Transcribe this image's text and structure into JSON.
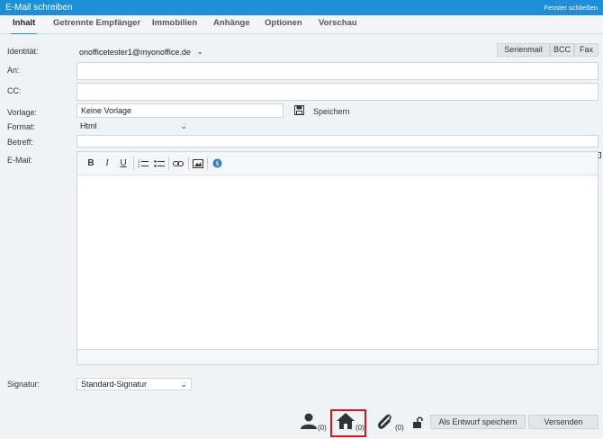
{
  "window": {
    "title": "E-Mail schreiben",
    "close_label": "Fenster schließen"
  },
  "tabs": [
    {
      "label": "Inhalt",
      "active": true
    },
    {
      "label": "Getrennte Empfänger",
      "active": false
    },
    {
      "label": "Immobilien",
      "active": false
    },
    {
      "label": "Anhänge",
      "active": false
    },
    {
      "label": "Optionen",
      "active": false
    },
    {
      "label": "Vorschau",
      "active": false
    }
  ],
  "form": {
    "identity_label": "Identität:",
    "identity_value": "onofficetester1@myonoffice.de",
    "to_label": "An:",
    "cc_label": "CC:",
    "template_label": "Vorlage:",
    "template_value": "Keine Vorlage",
    "save_template_label": "Speichern",
    "format_label": "Format:",
    "format_value": "Html",
    "subject_label": "Betreff:",
    "email_label": "E-Mail:",
    "signature_label": "Signatur:",
    "signature_value": "Standard-Signatur"
  },
  "top_buttons": {
    "serienmail": "Serienmail",
    "bcc": "BCC",
    "fax": "Fax"
  },
  "editor_toolbar": [
    "bold",
    "italic",
    "underline",
    "ordered-list",
    "unordered-list",
    "link",
    "image",
    "special"
  ],
  "toolbar_glyphs": {
    "bold": "B",
    "italic": "I",
    "underline": "U"
  },
  "footer": {
    "contacts_count": "(0)",
    "properties_count": "(0)",
    "attachments_count": "(0)",
    "draft_button": "Als Entwurf speichern",
    "send_button": "Versenden"
  },
  "colors": {
    "accent": "#1d8fd6",
    "highlight": "#d6141c"
  }
}
